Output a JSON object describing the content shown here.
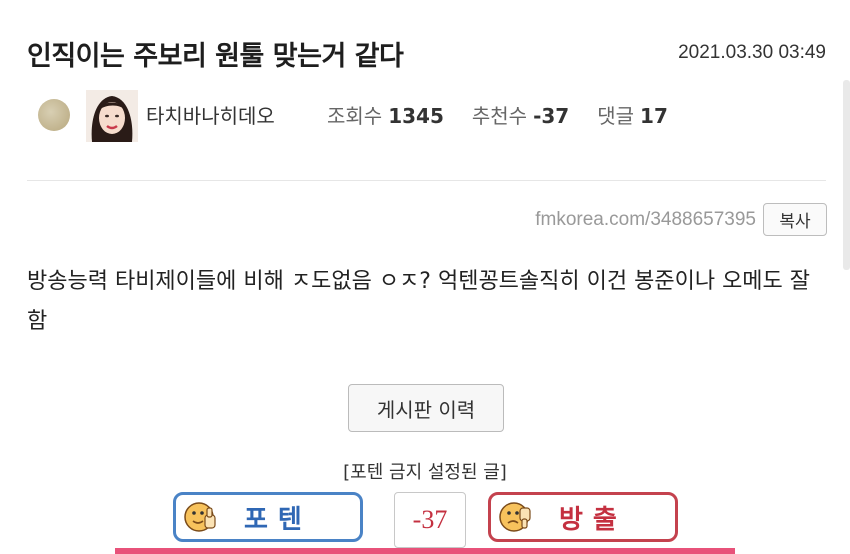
{
  "post": {
    "title": "인직이는 주보리 원툴 맞는거 같다",
    "date": "2021.03.30 03:49",
    "author": "타치바나히데오",
    "views_label": "조회수",
    "views": "1345",
    "recommend_label": "추천수",
    "recommend": "-37",
    "comments_label": "댓글",
    "comments": "17",
    "url": "fmkorea.com/3488657395",
    "copy_label": "복사",
    "body": "방송능력 타비제이들에 비해 ㅈ도없음 ㅇㅈ? 억텐꽁트솔직히 이건 봉준이나 오메도 잘함"
  },
  "actions": {
    "history_label": "게시판 이력",
    "notice": "[포텐 금지 설정된 글]",
    "upvote_label": "포텐",
    "downvote_label": "방출",
    "score": "-37"
  },
  "colors": {
    "upvote": "#4a83c6",
    "downvote": "#c4424e",
    "score": "#c43040",
    "bottom_bar": "#e8527a"
  },
  "icons": {
    "level": "level-badge-icon",
    "upvote": "thumbs-up-face-icon",
    "downvote": "thumbs-down-face-icon"
  }
}
